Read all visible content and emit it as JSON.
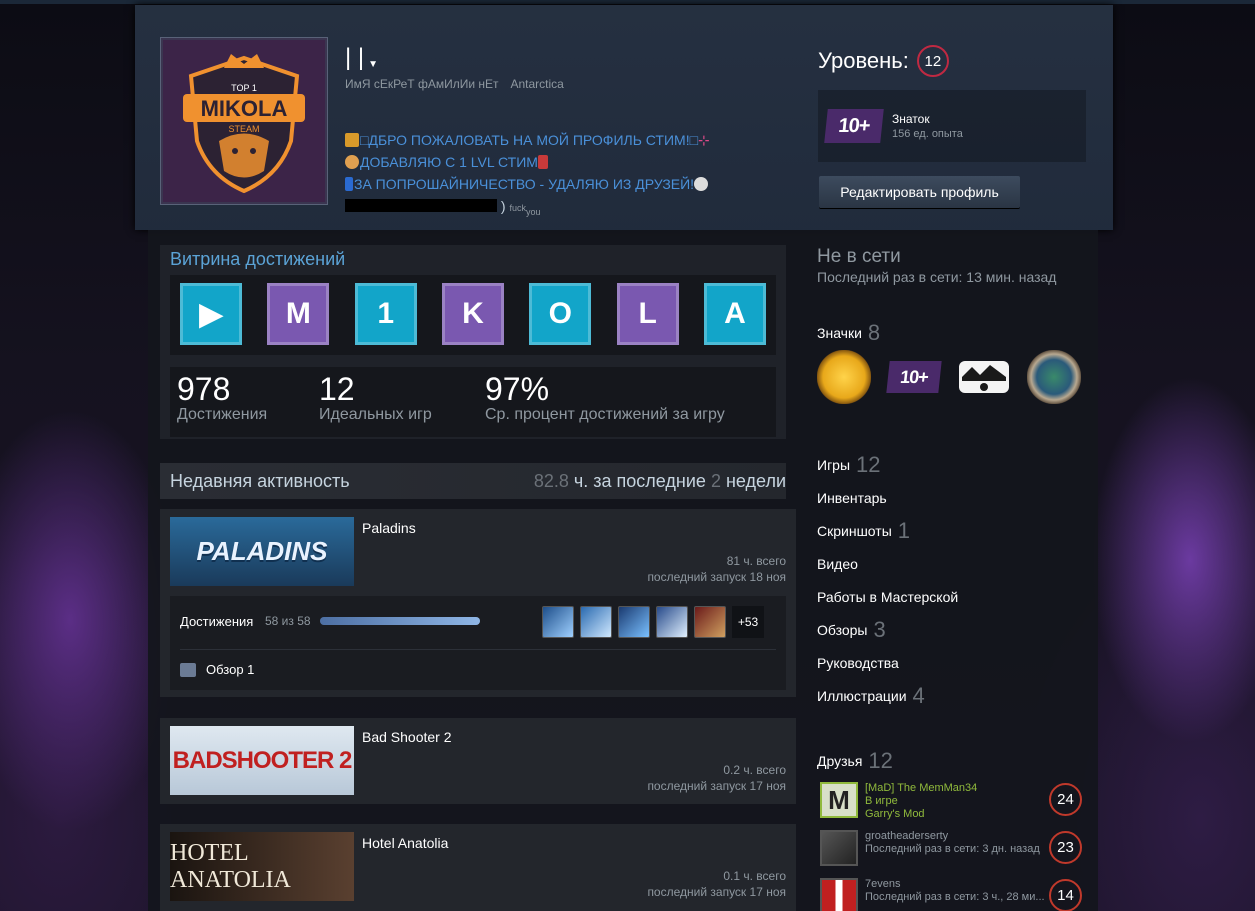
{
  "profile": {
    "persona_name": "|        |",
    "real_name": "ИмЯ сЕкРеТ фАмИлИи нЕт",
    "country": "Antarctica",
    "summary_lines": [
      "□ДБРО ПОЖАЛОВАТЬ НА МОЙ ПРОФИЛЬ СТИМ!□",
      "ДОБАВЛЯЮ С 1 LVL СТИМ",
      "ЗА ПОПРОШАЙНИЧЕСТВО - УДАЛЯЮ ИЗ ДРУЗЕЙ!"
    ],
    "summary_tail": ")",
    "summary_tiny": "fuck",
    "summary_tiny_sub": "you",
    "avatar_top": "TOP 1",
    "avatar_name": "MIKOLA",
    "avatar_sub": "STEAM",
    "level_label": "Уровень:",
    "level": "12",
    "badge_xp_text": "10+",
    "badge_name": "Знаток",
    "badge_xp": "156 ед. опыта",
    "edit_button": "Редактировать профиль"
  },
  "showcase": {
    "title": "Витрина достижений",
    "tiles": [
      {
        "label": "▶",
        "color": "blue"
      },
      {
        "label": "M",
        "color": "purple"
      },
      {
        "label": "1",
        "color": "blue"
      },
      {
        "label": "K",
        "color": "purple"
      },
      {
        "label": "O",
        "color": "blue"
      },
      {
        "label": "L",
        "color": "purple"
      },
      {
        "label": "A",
        "color": "blue"
      }
    ],
    "stats": [
      {
        "num": "978",
        "label": "Достижения"
      },
      {
        "num": "12",
        "label": "Идеальных игр"
      },
      {
        "num": "97%",
        "label": "Ср. процент достижений за игру"
      }
    ]
  },
  "recent": {
    "title": "Недавняя активность",
    "hours": "82.8",
    "hours_suffix": "ч. за последние",
    "weeks": "2",
    "weeks_suffix": "недели",
    "games": [
      {
        "name": "Paladins",
        "capsule_text": "PALADINS",
        "total": "81 ч. всего",
        "last": "последний запуск 18 ноя",
        "achievements_label": "Достижения",
        "achievements_count": "58 из 58",
        "achievements_progress": 1.0,
        "more": "+53",
        "review": "Обзор 1"
      },
      {
        "name": "Bad Shooter 2",
        "capsule_text": "BADSHOOTER 2",
        "total": "0.2 ч. всего",
        "last": "последний запуск 17 ноя"
      },
      {
        "name": "Hotel Anatolia",
        "capsule_text": "HOTEL ANATOLIA",
        "total": "0.1 ч. всего",
        "last": "последний запуск 17 ноя"
      }
    ]
  },
  "sidebar": {
    "status": "Не в сети",
    "last_online": "Последний раз в сети: 13 мин. назад",
    "badges_label": "Значки",
    "badges_count": "8",
    "badge_xp_small": "10+",
    "links": [
      {
        "label": "Игры",
        "count": "12"
      },
      {
        "label": "Инвентарь",
        "count": ""
      },
      {
        "label": "Скриншоты",
        "count": "1"
      },
      {
        "label": "Видео",
        "count": ""
      },
      {
        "label": "Работы в Мастерской",
        "count": ""
      },
      {
        "label": "Обзоры",
        "count": "3"
      },
      {
        "label": "Руководства",
        "count": ""
      },
      {
        "label": "Иллюстрации",
        "count": "4"
      }
    ],
    "friends_label": "Друзья",
    "friends_count": "12",
    "friends": [
      {
        "name": "[MaD] The MemMan34",
        "status": "В игре",
        "game": "Garry's Mod",
        "level": "24",
        "avatar_letter": "M"
      },
      {
        "name": "groatheaderserty",
        "status": "Последний раз в сети: 3 дн. назад",
        "game": "",
        "level": "23",
        "avatar_letter": ""
      },
      {
        "name": "7evens",
        "status": "Последний раз в сети: 3 ч., 28 ми...",
        "game": "",
        "level": "14",
        "avatar_letter": ""
      }
    ]
  },
  "colors": {
    "link_blue": "#4a90d9",
    "ingame_green": "#90ba3c",
    "level_ring": "#c02942"
  }
}
